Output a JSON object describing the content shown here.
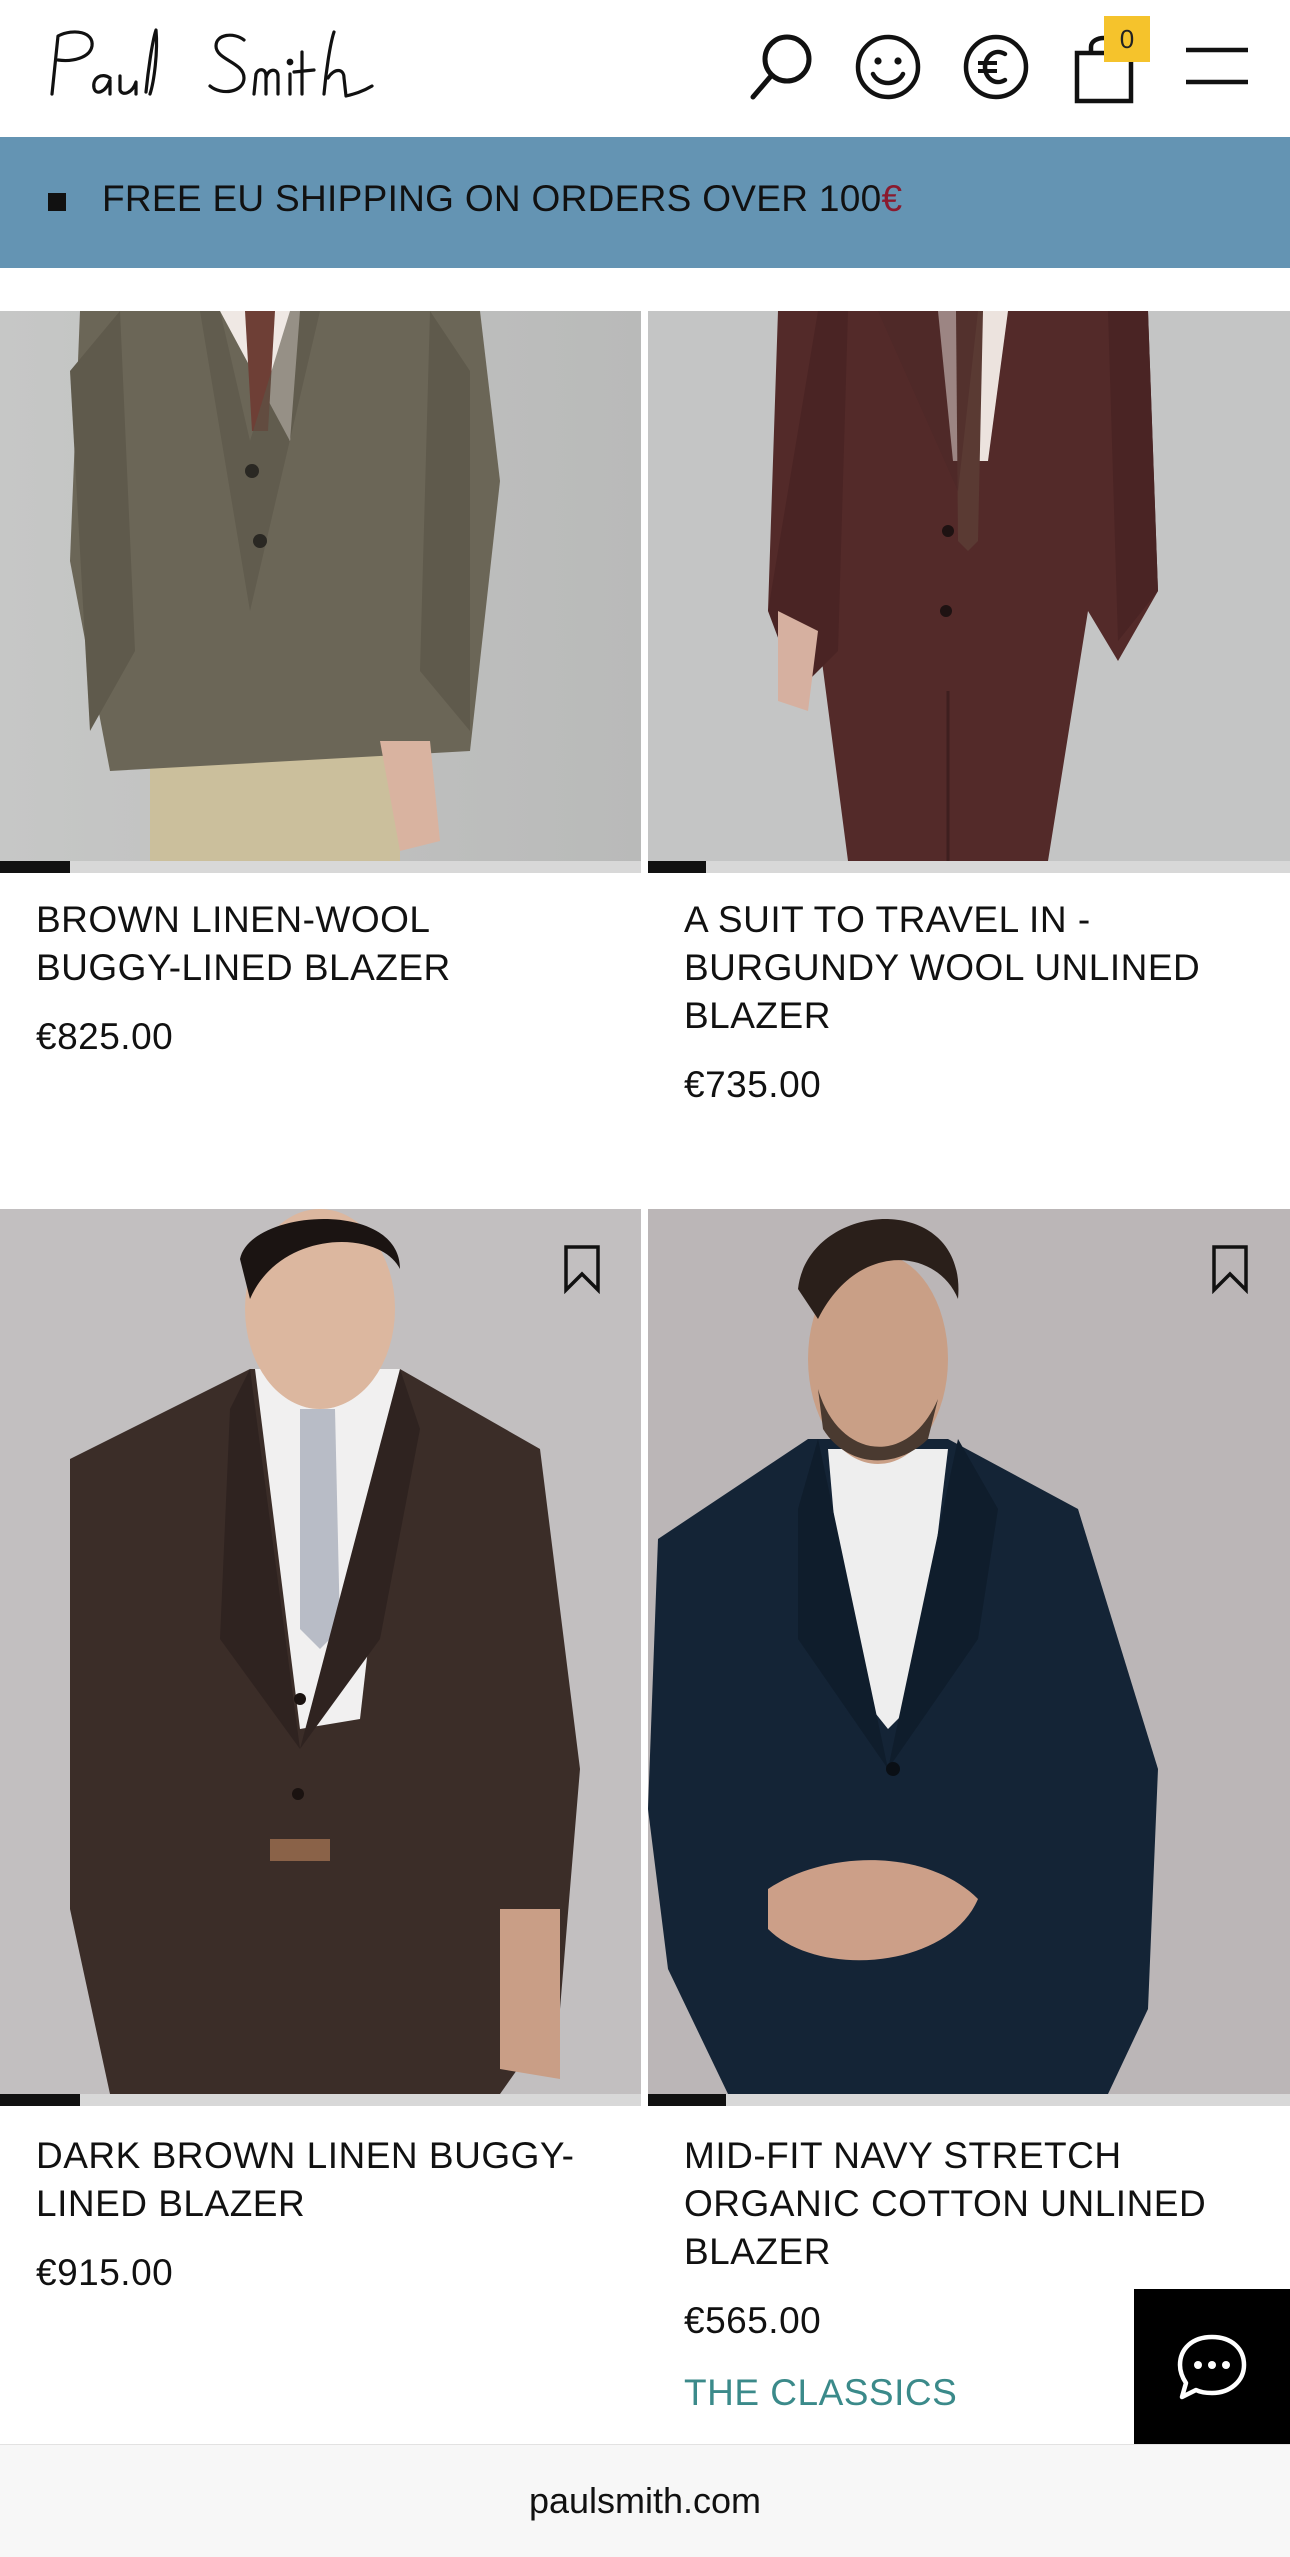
{
  "header": {
    "logo_text": "Paul Smith",
    "cart_count": "0",
    "icons": [
      "search-icon",
      "account-icon",
      "currency-icon",
      "bag-icon",
      "menu-icon"
    ],
    "accent_color": "#f5c32c"
  },
  "promo": {
    "text": "FREE EU SHIPPING ON ORDERS OVER 100",
    "currency_symbol": "€",
    "background": "#6494b3"
  },
  "products": [
    {
      "title_line1": "BROWN LINEN-WOOL",
      "title_line2": "BUGGY-LINED BLAZER",
      "title_line3": "",
      "price": "€825.00",
      "tag": ""
    },
    {
      "title_line1": "A SUIT TO TRAVEL IN -",
      "title_line2": "BURGUNDY WOOL UNLINED",
      "title_line3": "BLAZER",
      "price": "€735.00",
      "tag": ""
    },
    {
      "title_line1": "DARK BROWN LINEN BUGGY-",
      "title_line2": "LINED BLAZER",
      "title_line3": "",
      "price": "€915.00",
      "tag": ""
    },
    {
      "title_line1": "MID-FIT NAVY STRETCH",
      "title_line2": "ORGANIC COTTON UNLINED",
      "title_line3": "BLAZER",
      "price": "€565.00",
      "tag": "THE CLASSICS"
    }
  ],
  "browser": {
    "url": "paulsmith.com"
  }
}
